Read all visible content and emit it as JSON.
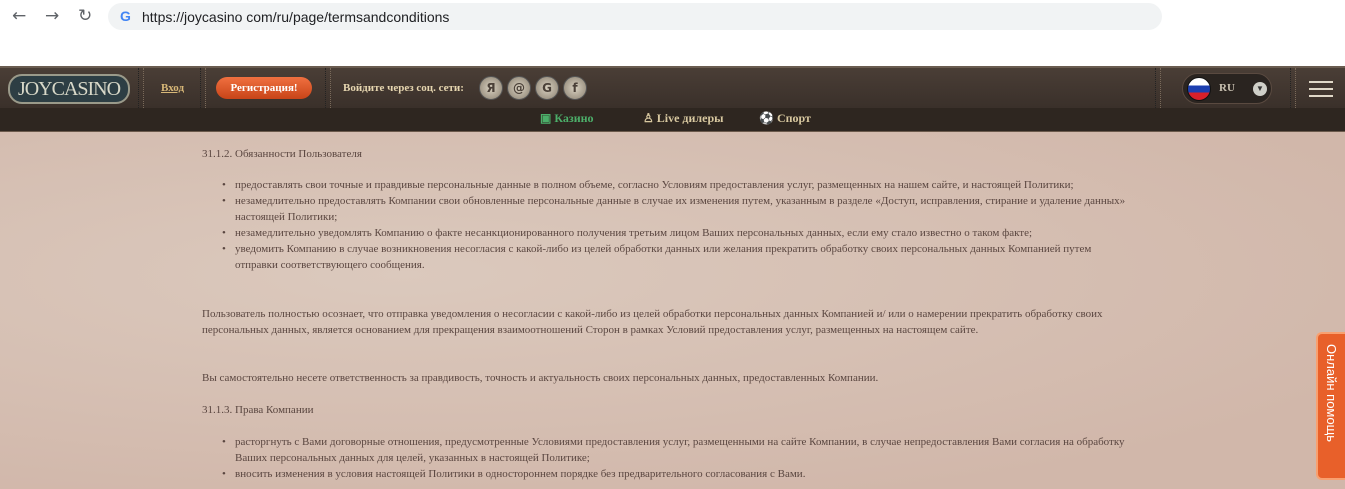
{
  "browser": {
    "url": "https://joycasino com/ru/page/termsandconditions"
  },
  "header": {
    "logo": "JOYCASINO",
    "login": "Вход",
    "register": "Регистрация!",
    "social_label": "Войдите через соц. сети:",
    "social": [
      "Я",
      "@",
      "G",
      "f"
    ],
    "lang": "RU"
  },
  "nav": {
    "tabs": [
      {
        "label": "Казино",
        "icon": "slot-icon"
      },
      {
        "label": "Live дилеры",
        "icon": "dealer-icon"
      },
      {
        "label": "Спорт",
        "icon": "ball-icon"
      }
    ]
  },
  "content": {
    "h1": "31.1.2. Обязанности Пользователя",
    "list1": [
      "предоставлять свои точные и правдивые персональные данные в полном объеме, согласно Условиям предоставления услуг, размещенных на нашем сайте, и настоящей Политики;",
      "незамедлительно предоставлять Компании свои обновленные персональные данные в случае их изменения путем, указанным в разделе «Доступ, исправления, стирание и удаление данных» настоящей Политики;",
      "незамедлительно уведомлять Компанию о факте несанкционированного получения третьим лицом Ваших персональных данных, если ему стало известно о таком факте;",
      "уведомить Компанию в случае возникновения несогласия с какой-либо из целей обработки данных или желания прекратить обработку своих персональных данных Компанией путем отправки соответствующего сообщения."
    ],
    "p1": "Пользователь полностью осознает, что отправка уведомления о несогласии с какой-либо из целей обработки персональных данных Компанией и/ или о намерении прекратить обработку своих персональных данных, является основанием для прекращения взаимоотношений Сторон в рамках Условий предоставления услуг, размещенных на настоящем сайте.",
    "p2": "Вы самостоятельно несете ответственность за правдивость, точность и актуальность своих персональных данных, предоставленных Компании.",
    "h2": "31.1.3. Права Компании",
    "list2": [
      "расторгнуть с Вами договорные отношения, предусмотренные Условиями предоставления услуг, размещенными на сайте Компании, в случае непредоставления Вами согласия на обработку Ваших персональных данных для целей, указанных в настоящей Политике;",
      "вносить изменения в условия настоящей Политики в одностороннем порядке без предварительного согласования с Вами."
    ]
  },
  "help": "Онлайн помощь"
}
